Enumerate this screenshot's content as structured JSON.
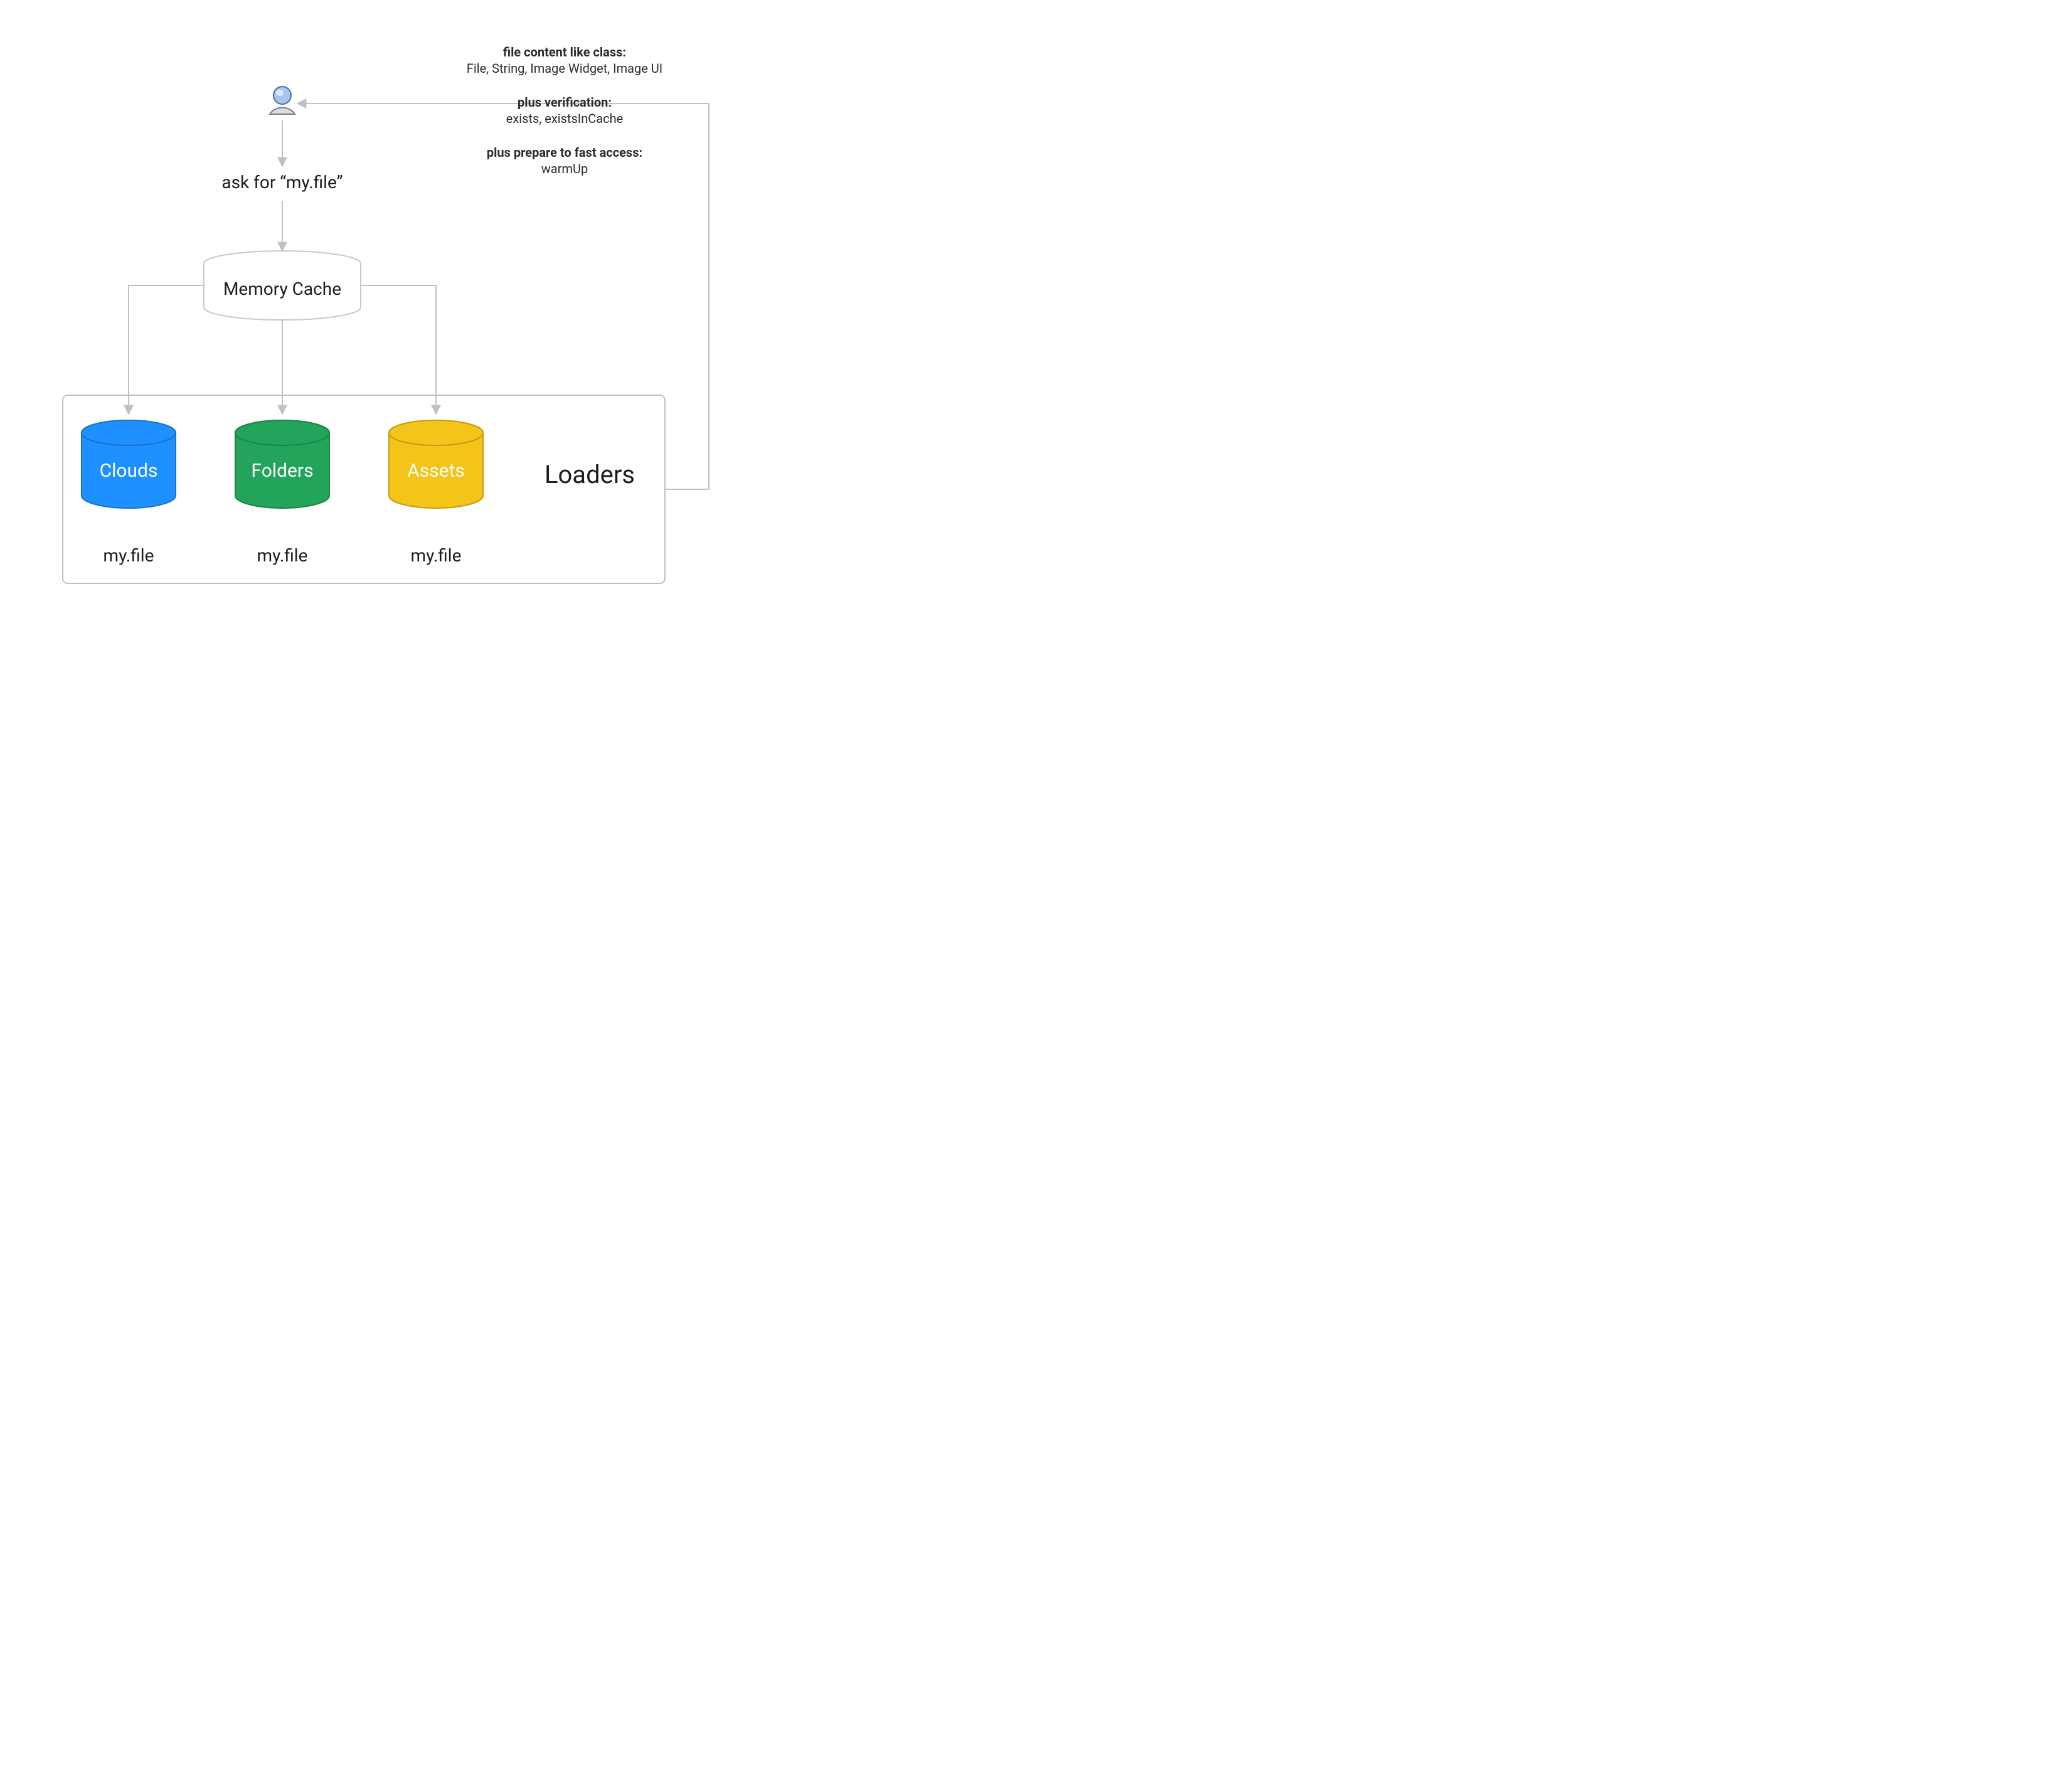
{
  "askLabel": "ask for “my.file”",
  "cacheLabel": "Memory Cache",
  "loadersLabel": "Loaders",
  "loaders": [
    {
      "name": "Clouds",
      "file": "my.file",
      "fill": "#1E90FF",
      "stroke": "#1873CC"
    },
    {
      "name": "Folders",
      "file": "my.file",
      "fill": "#22A55A",
      "stroke": "#1B8447"
    },
    {
      "name": "Assets",
      "file": "my.file",
      "fill": "#F4C418",
      "stroke": "#C49D13"
    }
  ],
  "notes": {
    "contentTitle": "file content like class:",
    "contentBody": "File, String, Image Widget, Image UI",
    "verifyTitle": "plus verification:",
    "verifyBody": "exists, existsInCache",
    "prepareTitle": "plus prepare to fast access:",
    "prepareBody": "warmUp"
  }
}
